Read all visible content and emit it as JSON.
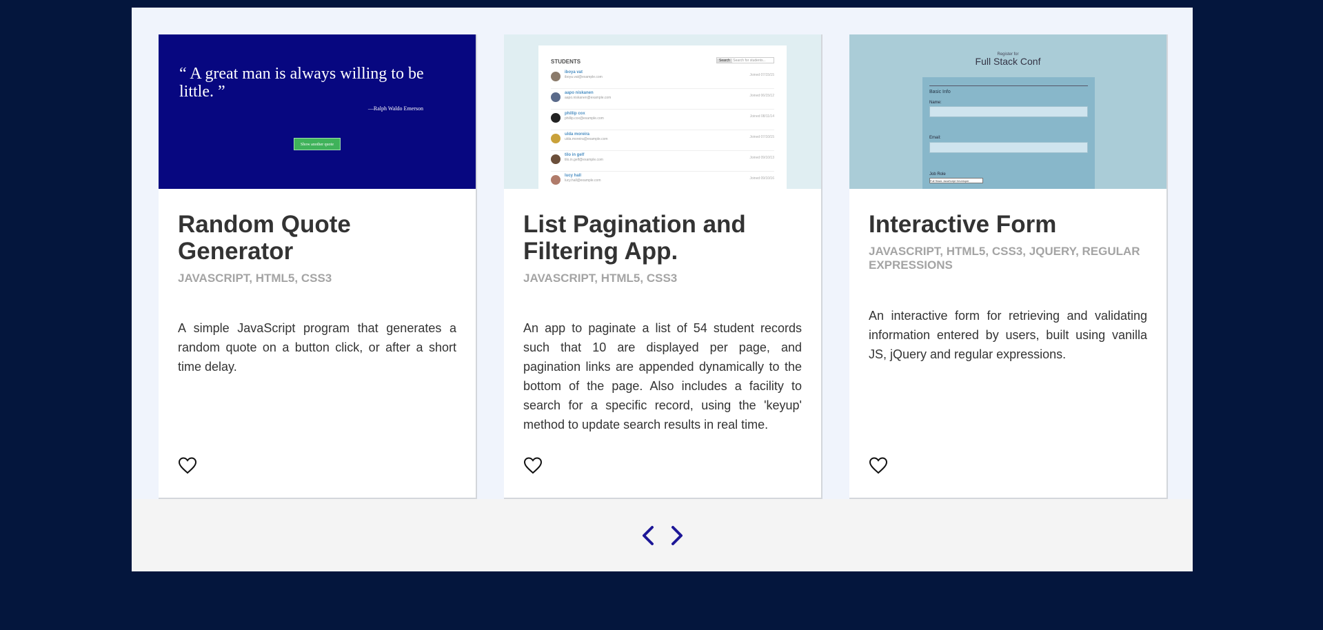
{
  "projects": [
    {
      "title": "Random Quote Generator",
      "tags": "JAVASCRIPT, HTML5, CSS3",
      "description": "A simple JavaScript program that generates a random quote on a button click, or after a short time delay.",
      "preview": {
        "quote": "“ A great man is always willing to be little. ”",
        "author": "—Ralph Waldo Emerson",
        "button": "Show another quote"
      }
    },
    {
      "title": "List Pagination and Filtering App.",
      "tags": "JAVASCRIPT, HTML5, CSS3",
      "description": "An app to paginate a list of 54 student records such that 10 are displayed per page, and pagination links are appended dynamically to the bottom of the page. Also includes a facility to search for a specific record, using the 'keyup' method to update search results in real time.",
      "preview": {
        "heading": "STUDENTS",
        "search_button": "Search",
        "search_placeholder": "Search for students...",
        "students": [
          {
            "name": "iboya vat",
            "email": "iboya.vat@example.com",
            "joined": "Joined 07/15/15"
          },
          {
            "name": "aapo niskanen",
            "email": "aapo.niskanen@example.com",
            "joined": "Joined 06/15/12"
          },
          {
            "name": "phillip cox",
            "email": "phillip.cox@example.com",
            "joined": "Joined 08/11/14"
          },
          {
            "name": "ulda moreira",
            "email": "ulda.moreira@example.com",
            "joined": "Joined 07/10/15"
          },
          {
            "name": "tilo in gelf",
            "email": "tilo.in.gelf@example.com",
            "joined": "Joined 09/10/13"
          },
          {
            "name": "lucy hall",
            "email": "lucy.hall@example.com",
            "joined": "Joined 09/10/16"
          }
        ]
      }
    },
    {
      "title": "Interactive Form",
      "tags": "JAVASCRIPT, HTML5, CSS3, JQUERY, REGULAR EXPRESSIONS",
      "description": "An interactive form for retrieving and validating information entered by users, built using vanilla JS, jQuery and regular expressions.",
      "preview": {
        "register_for": "Register for",
        "conf_name": "Full Stack Conf",
        "section": "Basic Info",
        "name_label": "Name:",
        "email_label": "Email:",
        "role_label": "Job Role",
        "role_value": "Full Stack JavaScript Developer"
      }
    }
  ],
  "pager": {
    "prev_icon": "chevron-left-icon",
    "next_icon": "chevron-right-icon",
    "accent": "#1d1797"
  },
  "colors": {
    "background": "#04163d",
    "panel": "#f0f4fc"
  }
}
